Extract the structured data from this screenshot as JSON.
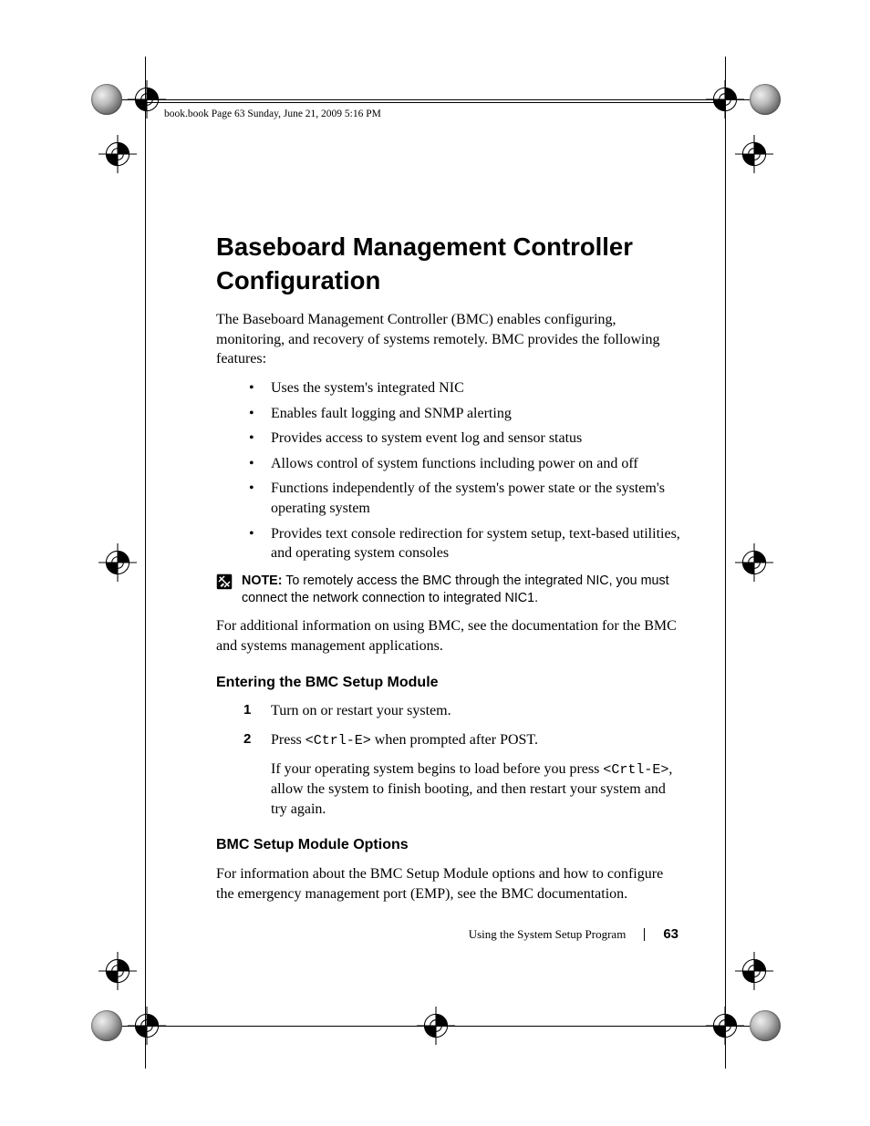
{
  "header_meta": "book.book  Page 63  Sunday, June 21, 2009  5:16 PM",
  "title": "Baseboard Management Controller Configuration",
  "intro": "The Baseboard Management Controller (BMC) enables configuring, monitoring, and recovery of systems remotely. BMC provides the following features:",
  "features": [
    "Uses the system's integrated NIC",
    "Enables fault logging and SNMP alerting",
    "Provides access to system event log and sensor status",
    "Allows control of system functions including power on and off",
    "Functions independently of the system's power state or the system's operating system",
    "Provides text console redirection for system setup, text-based utilities, and operating system consoles"
  ],
  "note_label": "NOTE:",
  "note_body": "To remotely access the BMC through the integrated NIC, you must connect the network connection to integrated NIC1.",
  "post_note": "For additional information on using BMC, see the documentation for the BMC and systems management applications.",
  "h2a": "Entering the BMC Setup Module",
  "steps": {
    "s1": "Turn on or restart your system.",
    "s2_pre": "Press ",
    "s2_key": "<Ctrl-E>",
    "s2_post": " when prompted after POST.",
    "s2b_pre": "If your operating system begins to load before you press ",
    "s2b_key": "<Crtl-E>",
    "s2b_post": ", allow the system to finish booting, and then restart your system and try again."
  },
  "h2b": "BMC Setup Module Options",
  "options_para": "For information about the BMC Setup Module options and how to configure the emergency management port (EMP), see the BMC documentation.",
  "footer_section": "Using the System Setup Program",
  "footer_page": "63"
}
